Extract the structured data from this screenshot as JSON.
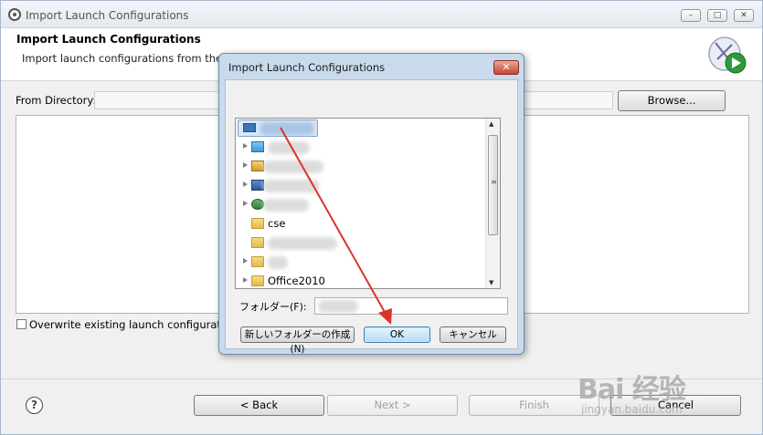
{
  "window": {
    "title": "Import Launch Configurations",
    "controls": [
      "–",
      "□",
      "✕"
    ]
  },
  "header": {
    "title": "Import Launch Configurations",
    "description": "Import launch configurations from the loca"
  },
  "from_directory": {
    "label": "From Directory:",
    "value": "",
    "browse_label": "Browse..."
  },
  "overwrite": {
    "label": "Overwrite existing launch configurations w",
    "checked": false
  },
  "footer": {
    "help": "?",
    "back": "< Back",
    "next": "Next >",
    "finish": "Finish",
    "cancel": "Cancel"
  },
  "dialog": {
    "title": "Import Launch Configurations",
    "close": "✕",
    "tree_items": [
      {
        "label": "",
        "icon": "desktop-icon",
        "selected": true,
        "expander": false
      },
      {
        "label": "",
        "icon": "library-icon",
        "expander": true
      },
      {
        "label": "",
        "icon": "user-icon",
        "expander": true
      },
      {
        "label": "",
        "icon": "computer-icon",
        "expander": true
      },
      {
        "label": "",
        "icon": "network-icon",
        "expander": true
      },
      {
        "label": "cse",
        "icon": "folder-icon",
        "expander": false
      },
      {
        "label": "",
        "icon": "folder-icon",
        "expander": false
      },
      {
        "label": "",
        "icon": "folder-icon",
        "expander": true
      },
      {
        "label": "Office2010",
        "icon": "folder-icon",
        "expander": true
      }
    ],
    "folder_label": "フォルダー(F):",
    "folder_value": "",
    "new_folder_button": "新しいフォルダーの作成(N)",
    "ok_button": "OK",
    "cancel_button": "キャンセル"
  },
  "watermark": {
    "logo": "Bai 经验",
    "url": "jingyan.baidu.com"
  },
  "annotation_color": "#d9342b"
}
